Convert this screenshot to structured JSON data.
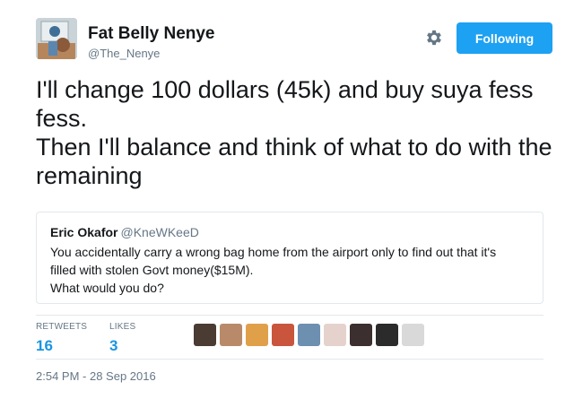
{
  "author": {
    "name": "Fat Belly Nenye",
    "handle": "@The_Nenye"
  },
  "follow_button": {
    "label": "Following",
    "color": "#1da1f2"
  },
  "tweet": {
    "lines": [
      "I'll change 100 dollars (45k) and buy suya fess",
      "fess.",
      "Then I'll balance and think of what to do with the",
      "remaining"
    ]
  },
  "quoted_tweet": {
    "name": "Eric Okafor",
    "handle": "@KneWKeeD",
    "lines": [
      "You accidentally carry a wrong bag home from the airport only to find out that it's",
      "filled with stolen Govt money($15M).",
      "What would you do?"
    ]
  },
  "stats": {
    "retweets_label": "RETWEETS",
    "retweets_count": "16",
    "likes_label": "LIKES",
    "likes_count": "3"
  },
  "likers": [
    {
      "color": "#4a3b33"
    },
    {
      "color": "#b98a6a"
    },
    {
      "color": "#e0a04a"
    },
    {
      "color": "#c9553d"
    },
    {
      "color": "#6d8fb0"
    },
    {
      "color": "#e6d2cc"
    },
    {
      "color": "#3c2f2f"
    },
    {
      "color": "#2b2b2b"
    },
    {
      "color": "#d9d9d9"
    }
  ],
  "timestamp": "2:54 PM - 28 Sep 2016",
  "colors": {
    "link_blue": "#1b95e0",
    "secondary_text": "#657786",
    "border": "#e1e8ed"
  }
}
